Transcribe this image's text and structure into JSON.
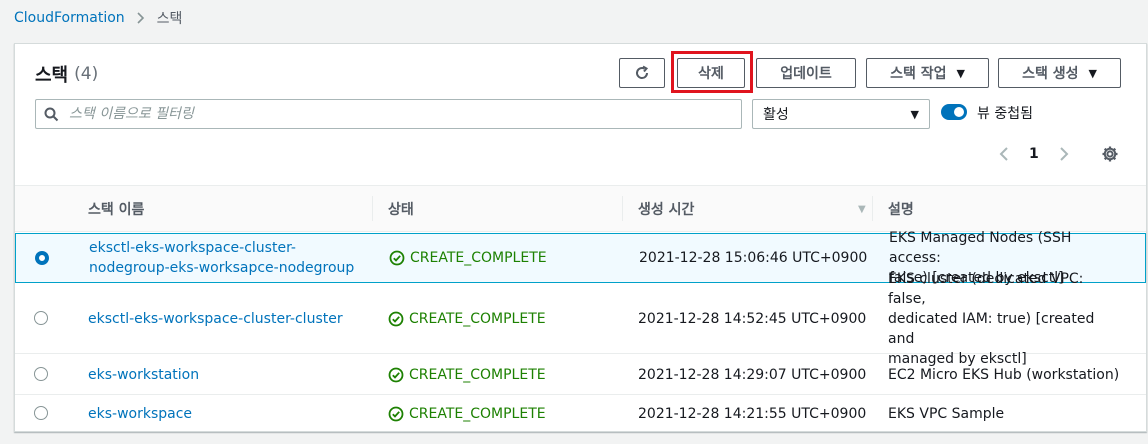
{
  "breadcrumb": {
    "root": "CloudFormation",
    "current": "스택"
  },
  "panel": {
    "title": "스택",
    "count": "(4)",
    "buttons": {
      "delete": "삭제",
      "update": "업데이트",
      "stack_actions": "스택 작업",
      "create_stack": "스택 생성"
    },
    "search": {
      "placeholder": "스택 이름으로 필터링",
      "value": ""
    },
    "filter_select": {
      "selected": "활성"
    },
    "nested_toggle": {
      "label": "뷰 중첩됨",
      "on": true
    },
    "pagination": {
      "page": "1"
    }
  },
  "table": {
    "columns": [
      "스택 이름",
      "상태",
      "생성 시간",
      "설명"
    ],
    "rows": [
      {
        "name_line1": "eksctl-eks-workspace-cluster-",
        "name_line2": "nodegroup-eks-worksapce-nodegroup",
        "status": "CREATE_COMPLETE",
        "created": "2021-12-28 15:06:46 UTC+0900",
        "desc_line1": "EKS Managed Nodes (SSH access:",
        "desc_line2": "false) [created by eksctl]",
        "selected": true
      },
      {
        "name": "eksctl-eks-workspace-cluster-cluster",
        "status": "CREATE_COMPLETE",
        "created": "2021-12-28 14:52:45 UTC+0900",
        "desc_line1": "EKS cluster (dedicated VPC: false,",
        "desc_line2": "dedicated IAM: true) [created and",
        "desc_line3": "managed by eksctl]",
        "selected": false
      },
      {
        "name": "eks-workstation",
        "status": "CREATE_COMPLETE",
        "created": "2021-12-28 14:29:07 UTC+0900",
        "desc": "EC2 Micro EKS Hub (workstation)",
        "selected": false
      },
      {
        "name": "eks-workspace",
        "status": "CREATE_COMPLETE",
        "created": "2021-12-28 14:21:55 UTC+0900",
        "desc": "EKS VPC Sample",
        "selected": false
      }
    ]
  },
  "colors": {
    "link": "#0073bb",
    "success": "#1d8102",
    "highlight": "#e0141e",
    "selected_bg": "#f1faff"
  },
  "icons": [
    "refresh-icon",
    "search-icon",
    "caret-down-icon",
    "chevron-left-icon",
    "chevron-right-icon",
    "gear-icon",
    "check-circle-icon",
    "chevron-right-breadcrumb-icon"
  ]
}
